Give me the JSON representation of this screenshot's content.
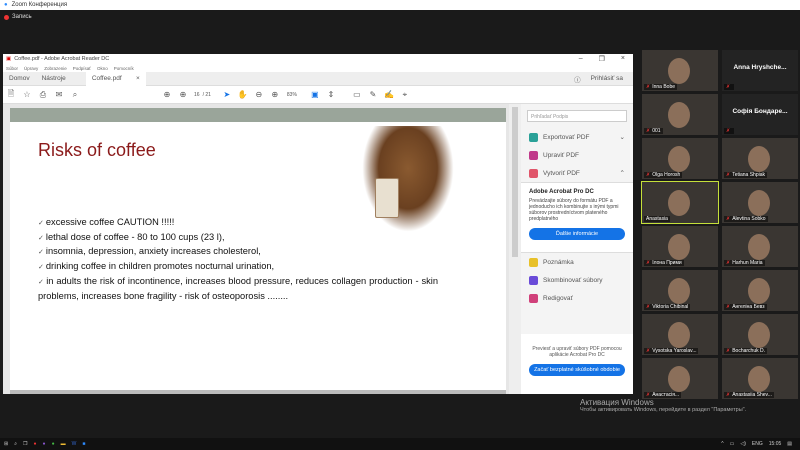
{
  "zoom": {
    "title": "Zoom Конференция",
    "recording": "Запись"
  },
  "acrobat": {
    "window_title": "Coffee.pdf - Adobe Acrobat Reader DC",
    "menu": [
      "Súbor",
      "Úpravy",
      "Zobrazenie",
      "Podpísať",
      "Okno",
      "Pomocník"
    ],
    "tabs": {
      "home": "Domov",
      "tools": "Nástroje",
      "doc": "Coffee.pdf",
      "close": "×"
    },
    "signin": "Prihlásiť sa",
    "page_current": "16",
    "page_total": "/ 21",
    "zoom_level": "83%"
  },
  "slide": {
    "title": "Risks of coffee",
    "bullets": [
      "excessive coffee CAUTION !!!!!",
      "lethal dose of coffee - 80 to 100 cups (23 l),",
      "insomnia, depression, anxiety increases cholesterol,",
      "drinking coffee in children promotes nocturnal urination,",
      "in adults the risk of incontinence, increases blood pressure, reduces collagen production - skin problems, increases bone fragility - risk of osteoporosis ........"
    ]
  },
  "pane": {
    "sign_placeholder": "Prihľadať Podpis",
    "tools": [
      {
        "label": "Exportovať PDF",
        "color": "#2aa198",
        "chev": "⌄"
      },
      {
        "label": "Upraviť PDF",
        "color": "#c0398a",
        "chev": ""
      },
      {
        "label": "Vytvoriť PDF",
        "color": "#e0556a",
        "chev": "⌃"
      }
    ],
    "promo_title": "Adobe Acrobat Pro DC",
    "promo_text": "Prevádzajte súbory do formátu PDF a jednoducho ich kombinujte s inými typmi súborov prostredníctvom plateného predplatného",
    "promo_button": "Ďalšie informácie",
    "tools2": [
      {
        "label": "Poznámka",
        "color": "#e8c12a"
      },
      {
        "label": "Skombinovať súbory",
        "color": "#6a4bd8"
      },
      {
        "label": "Redigovať",
        "color": "#d0407a"
      }
    ],
    "footer_text": "Previesť a upraviť súbory PDF pomocou aplikácie Acrobat Pro DC",
    "footer_button": "Začať bezplatné skúšobné obdobie"
  },
  "participants": [
    {
      "name": "Inna Bobe",
      "video": true
    },
    {
      "name": "Anna Hryshche...",
      "video": false
    },
    {
      "name": "001",
      "video": true
    },
    {
      "name": "Софія Бондаре...",
      "video": false
    },
    {
      "name": "Olga Horosh",
      "video": true
    },
    {
      "name": "Tetiana Shpiak",
      "video": true
    },
    {
      "name": "Anastasia",
      "video": true,
      "active": true
    },
    {
      "name": "Alevtina Sobko",
      "video": true
    },
    {
      "name": "Ілона Прими",
      "video": true
    },
    {
      "name": "Harhun Maria",
      "video": true
    },
    {
      "name": "Viktoria Chibinal",
      "video": true
    },
    {
      "name": "Ангеліна Бевз",
      "video": true
    },
    {
      "name": "Vysotska Yaroslav...",
      "video": true
    },
    {
      "name": "Bocharchuk D.",
      "video": true
    },
    {
      "name": "Анастасія...",
      "video": true
    },
    {
      "name": "Anastasiia Shev...",
      "video": true
    }
  ],
  "activation": {
    "title": "Активация Windows",
    "text": "Чтобы активировать Windows, перейдите в раздел \"Параметры\"."
  },
  "taskbar": {
    "lang": "ENG",
    "time": "15:05"
  }
}
